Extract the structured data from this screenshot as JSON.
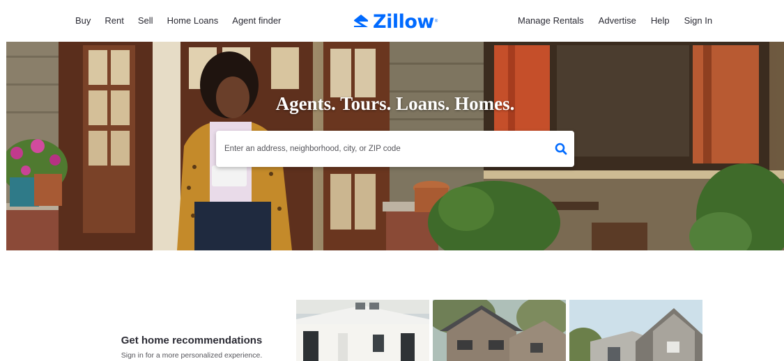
{
  "header": {
    "nav_left": [
      "Buy",
      "Rent",
      "Sell",
      "Home Loans",
      "Agent finder"
    ],
    "nav_right": [
      "Manage Rentals",
      "Advertise",
      "Help",
      "Sign In"
    ],
    "logo_text": "Zillow",
    "logo_mark": "®",
    "logo_icon": "zillow-z-icon",
    "brand_color": "#006aff"
  },
  "hero": {
    "title": "Agents. Tours. Loans. Homes.",
    "search_placeholder": "Enter an address, neighborhood, city, or ZIP code",
    "search_icon": "search-icon"
  },
  "recommendations": {
    "title": "Get home recommendations",
    "subtitle": "Sign in for a more personalized experience."
  }
}
